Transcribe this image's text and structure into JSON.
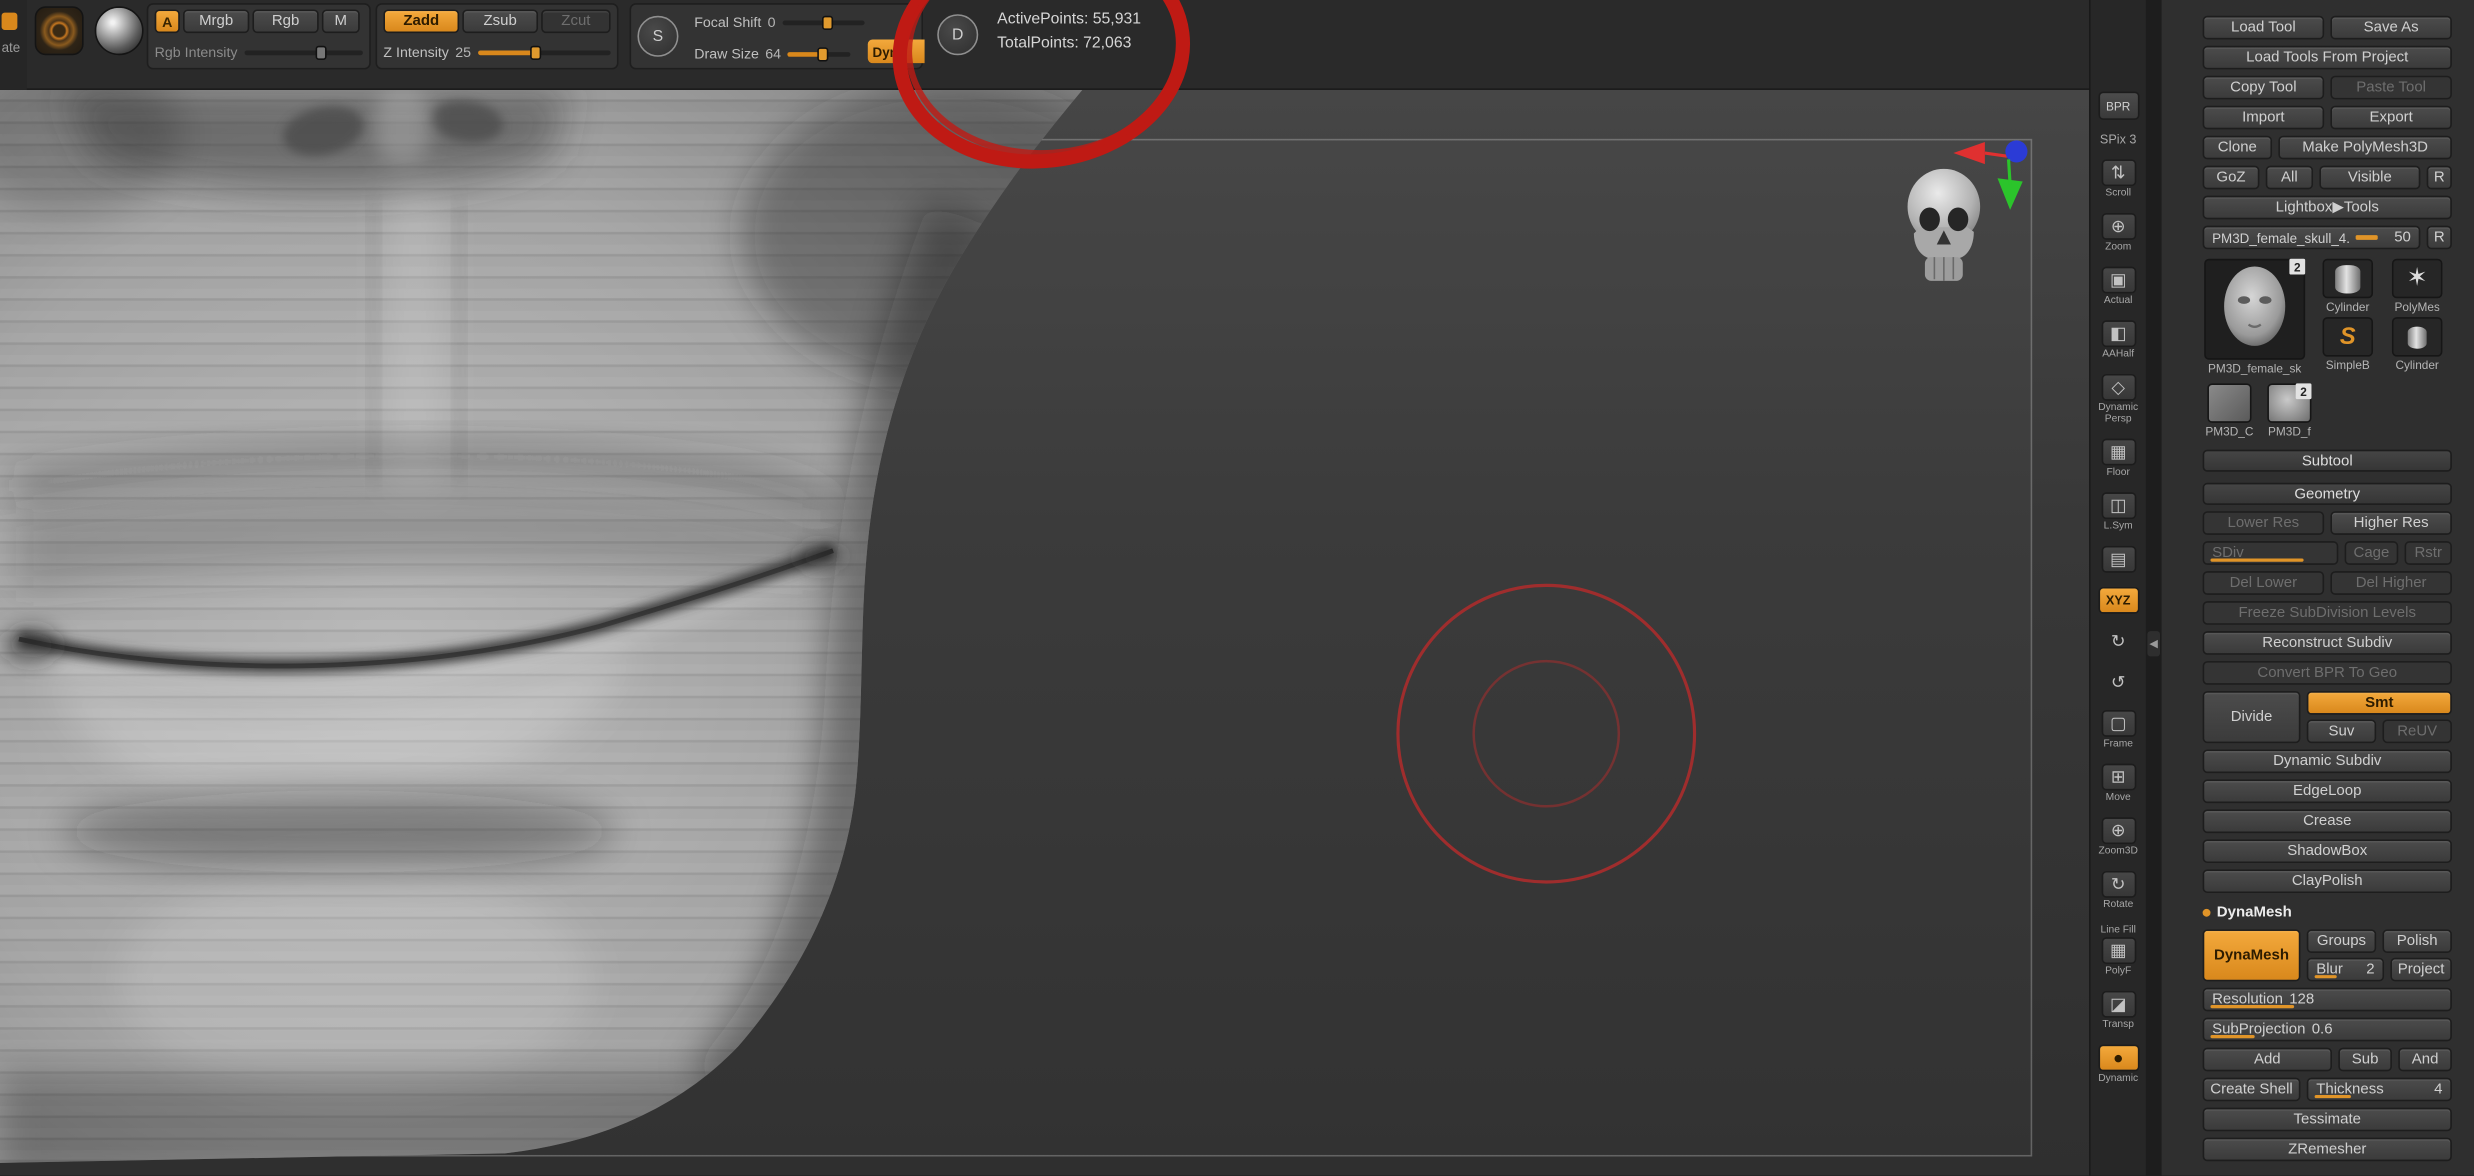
{
  "accent": {
    "orange": "#e09428",
    "annotation_red": "#bf1a14",
    "cursor_red": "#b22c2c"
  },
  "topbar": {
    "edge_label": "ate",
    "color": {
      "swatch": "A",
      "mrgb": "Mrgb",
      "rgb": "Rgb",
      "m": "M",
      "rgb_intensity": "Rgb Intensity"
    },
    "sculpt": {
      "zadd": "Zadd",
      "zsub": "Zsub",
      "zcut": "Zcut",
      "z_intensity": "Z Intensity",
      "z_intensity_value": "25"
    },
    "stroke": {
      "icon": "S",
      "focal_shift": "Focal Shift",
      "focal_shift_value": "0",
      "draw_size": "Draw Size",
      "draw_size_value": "64",
      "dyna": "Dyna"
    },
    "points": {
      "icon": "D",
      "active": "ActivePoints: 55,931",
      "total": "TotalPoints: 72,063"
    }
  },
  "strip": {
    "items": [
      {
        "name": "bpr",
        "label": "BPR",
        "glyph": ""
      },
      {
        "name": "spix",
        "label": "SPix",
        "value": "3",
        "glyph": ""
      },
      {
        "name": "scroll",
        "label": "Scroll",
        "glyph": "⇅"
      },
      {
        "name": "zoom",
        "label": "Zoom",
        "glyph": "⊕"
      },
      {
        "name": "actual",
        "label": "Actual",
        "glyph": "▣"
      },
      {
        "name": "aahalf",
        "label": "AAHalf",
        "glyph": "◧"
      },
      {
        "name": "persp",
        "label": "Dynamic Persp",
        "glyph": "◇"
      },
      {
        "name": "floor",
        "label": "Floor",
        "glyph": "▦"
      },
      {
        "name": "lsym",
        "label": "L.Sym",
        "glyph": "◫"
      },
      {
        "name": "local",
        "label": "",
        "glyph": "▤"
      },
      {
        "name": "xyz",
        "label": "XYZ",
        "glyph": "XYZ"
      },
      {
        "name": "spin-cw",
        "label": "",
        "glyph": "↻"
      },
      {
        "name": "spin-ccw",
        "label": "",
        "glyph": "↺"
      },
      {
        "name": "frame",
        "label": "Frame",
        "glyph": "▢"
      },
      {
        "name": "move",
        "label": "Move",
        "glyph": "⊞"
      },
      {
        "name": "zoom3d",
        "label": "Zoom3D",
        "glyph": "⊕"
      },
      {
        "name": "rotate",
        "label": "Rotate",
        "glyph": "↻"
      },
      {
        "name": "polyframe",
        "label": "Line Fill",
        "label2": "PolyF",
        "glyph": "▦"
      },
      {
        "name": "transp",
        "label": "Transp",
        "glyph": "◪"
      },
      {
        "name": "solo",
        "label": "Dynamic",
        "glyph": "●"
      }
    ]
  },
  "tool_panel": {
    "load_tool": "Load Tool",
    "save_as": "Save As",
    "load_from_project": "Load Tools From Project",
    "copy_tool": "Copy Tool",
    "paste_tool": "Paste Tool",
    "import": "Import",
    "export": "Export",
    "clone": "Clone",
    "make_polymesh": "Make PolyMesh3D",
    "goz": "GoZ",
    "all": "All",
    "visible": "Visible",
    "r1": "R",
    "lightbox": "Lightbox▶Tools",
    "active_tool": "PM3D_female_skull_4.",
    "active_tool_value": "50",
    "r2": "R",
    "thumbs": [
      {
        "label": "PM3D_female_sk",
        "badge": "2"
      },
      {
        "label": "Cylinder"
      },
      {
        "label": "PolyMes"
      },
      {
        "label": "SimpleB"
      },
      {
        "label": "Cylinder"
      },
      {
        "label": "PM3D_C"
      },
      {
        "label": "PM3D_f",
        "badge": "2"
      }
    ],
    "subtool_header": "Subtool",
    "geometry_header": "Geometry",
    "geometry": {
      "lower_res": "Lower Res",
      "higher_res": "Higher Res",
      "sdiv": "SDiv",
      "cage": "Cage",
      "rstr": "Rstr",
      "del_lower": "Del Lower",
      "del_higher": "Del Higher",
      "freeze": "Freeze SubDivision Levels",
      "reconstruct": "Reconstruct Subdiv",
      "convert_bpr": "Convert BPR To Geo",
      "divide": "Divide",
      "smt": "Smt",
      "suv": "Suv",
      "reuv": "ReUV",
      "dynamic_subdiv": "Dynamic Subdiv",
      "edgeloop": "EdgeLoop",
      "crease": "Crease",
      "shadowbox": "ShadowBox",
      "claypolish": "ClayPolish"
    },
    "dynamesh": {
      "header": "DynaMesh",
      "button": "DynaMesh",
      "groups": "Groups",
      "polish": "Polish",
      "blur": "Blur",
      "blur_value": "2",
      "project": "Project",
      "resolution": "Resolution",
      "resolution_value": "128",
      "subprojection": "SubProjection",
      "subprojection_value": "0.6",
      "add": "Add",
      "sub": "Sub",
      "and": "And",
      "create_shell": "Create Shell",
      "thickness": "Thickness",
      "thickness_value": "4",
      "tessimate": "Tessimate",
      "zremesher": "ZRemesher"
    }
  }
}
